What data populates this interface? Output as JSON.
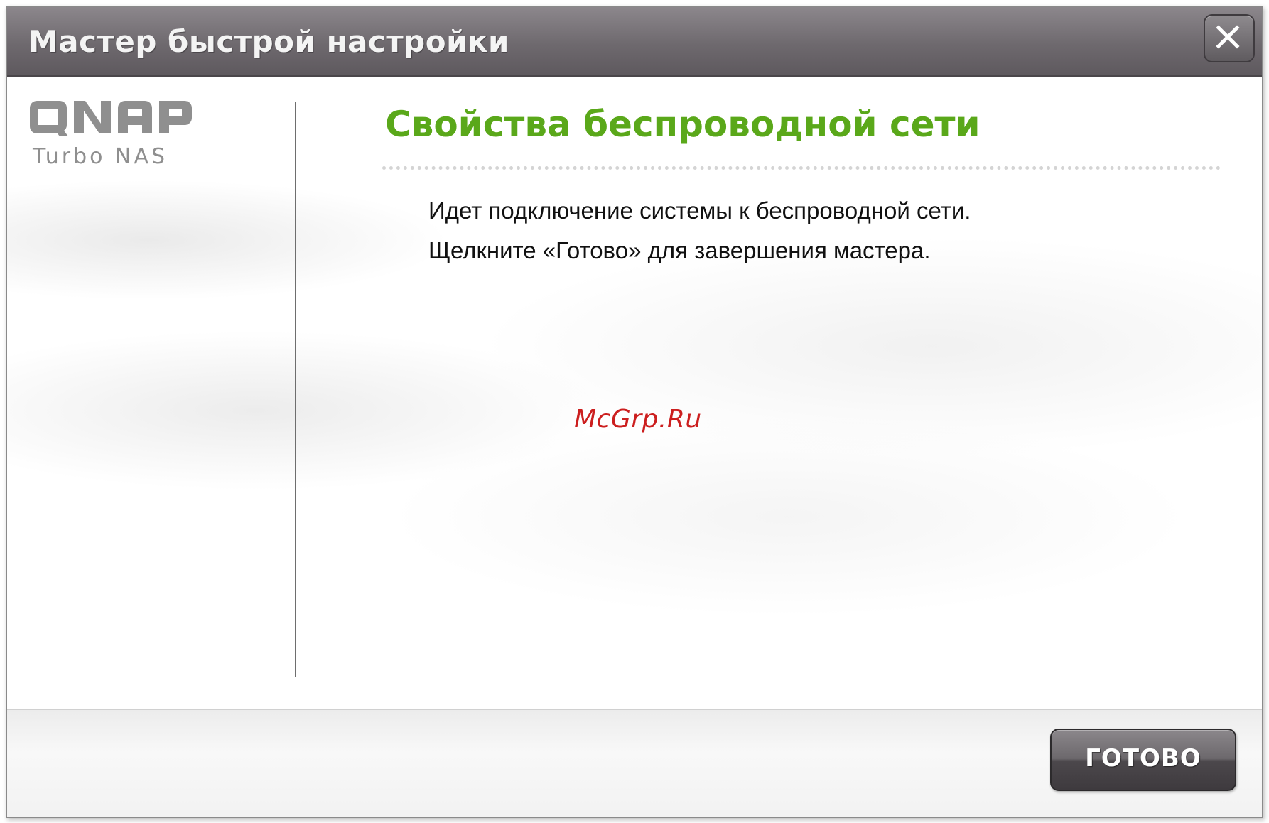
{
  "window": {
    "title": "Мастер быстрой настройки",
    "close_icon": "close-icon"
  },
  "sidebar": {
    "logo_text": "QNAP",
    "logo_subtext": "Turbo NAS",
    "logo_color": "#8f8f8f"
  },
  "main": {
    "heading": "Свойства беспроводной сети",
    "heading_color": "#5aa81a",
    "message_line1": "Идет подключение системы к беспроводной сети.",
    "message_line2": "Щелкните «Готово» для завершения мастера."
  },
  "watermark": {
    "text": "McGrp.Ru",
    "color": "#cc1f1f"
  },
  "footer": {
    "done_label": "ГОТОВО"
  }
}
